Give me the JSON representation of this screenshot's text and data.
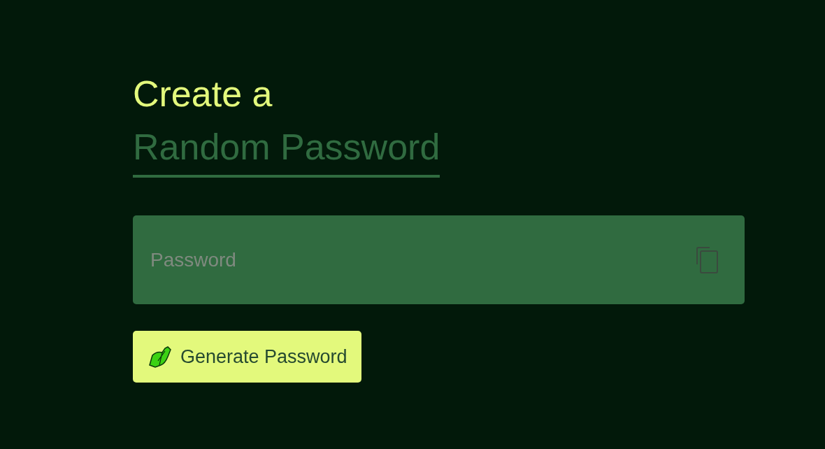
{
  "heading": {
    "line_1": "Create a",
    "line_2": "Random Password"
  },
  "password_field": {
    "placeholder": "Password"
  },
  "generate_button": {
    "label": "Generate Password"
  }
}
